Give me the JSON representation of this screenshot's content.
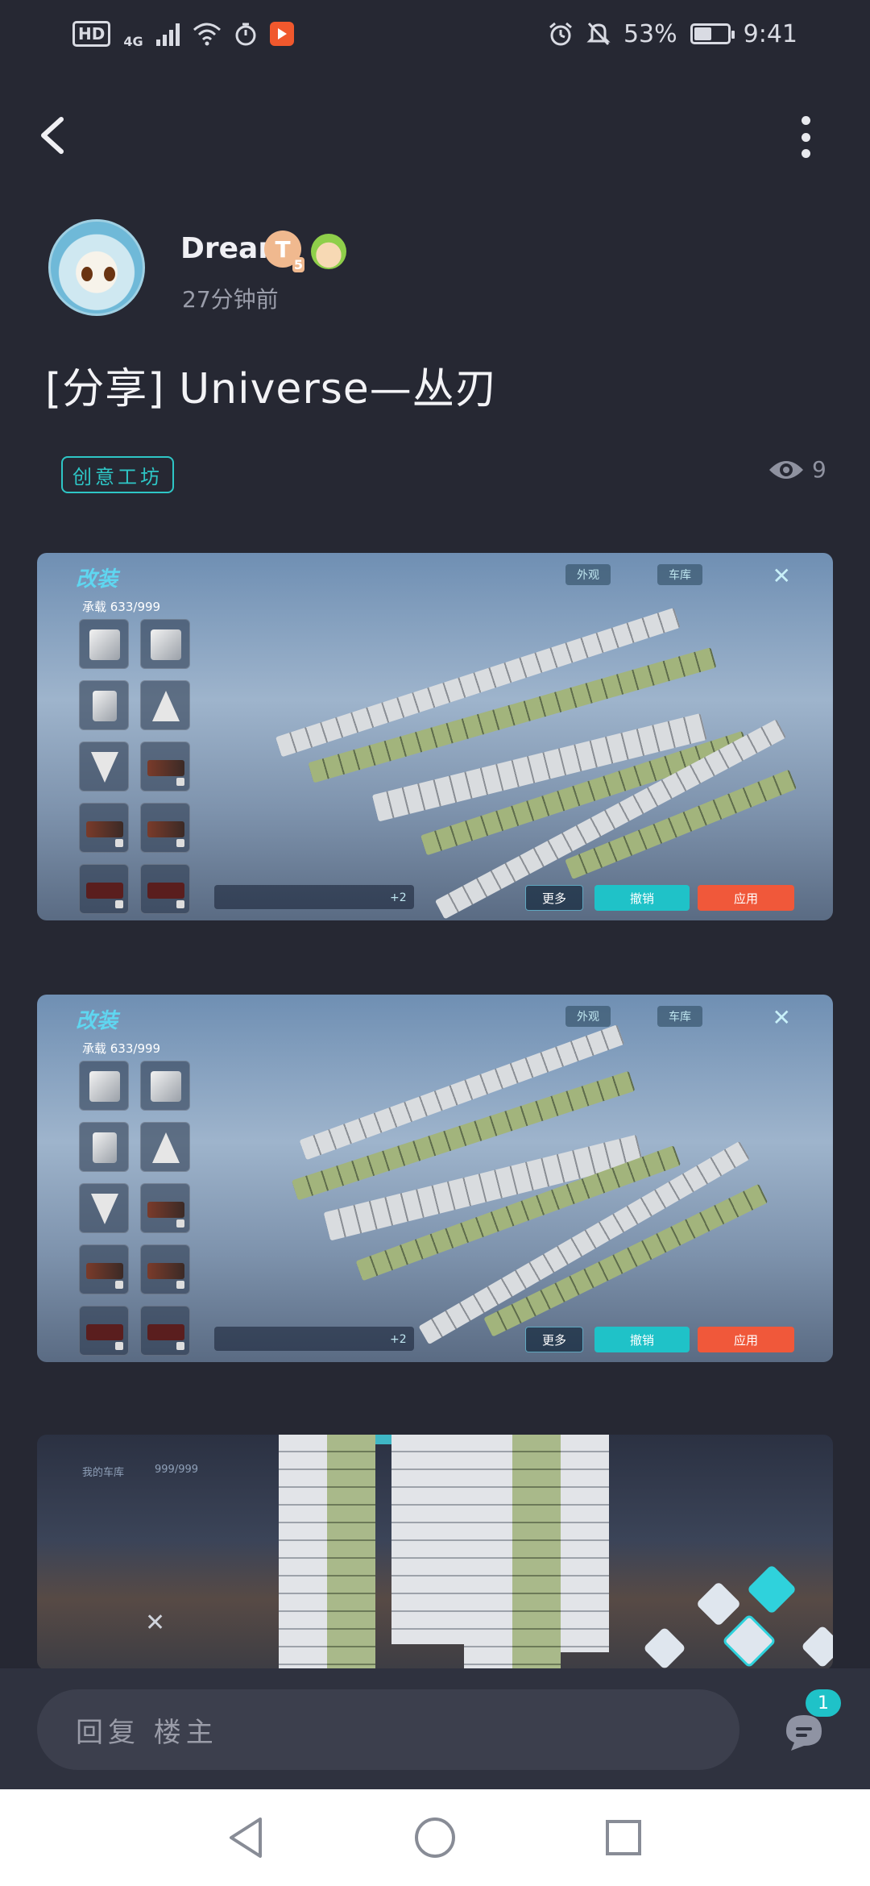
{
  "status_bar": {
    "hd_label": "HD",
    "network_label": "4G",
    "battery_percent_text": "53%",
    "battery_level": 0.53,
    "time": "9:41"
  },
  "post": {
    "author": {
      "name": "Dream",
      "level_badge": "T",
      "level_sub": "5",
      "time_ago": "27分钟前"
    },
    "title": "[分享] Universe—丛刃",
    "tag": "创意工坊",
    "view_count": "9"
  },
  "screenshots": [
    {
      "title": "改装",
      "capacity": "承载 633/999",
      "tabs": [
        "外观",
        "车库"
      ],
      "slot_plus": "+2",
      "buttons": {
        "more": "更多",
        "undo": "撤销",
        "apply": "应用"
      }
    },
    {
      "title": "改装",
      "capacity": "承载 633/999",
      "tabs": [
        "外观",
        "车库"
      ],
      "slot_plus": "+2",
      "buttons": {
        "more": "更多",
        "undo": "撤销",
        "apply": "应用"
      }
    },
    {
      "caption": "我的车库",
      "counter": "999/999"
    }
  ],
  "reply": {
    "placeholder": "回复 楼主",
    "comment_count": "1"
  },
  "colors": {
    "background": "#262833",
    "accent_teal": "#2ec6c6",
    "undo_button": "#1fc2c8",
    "apply_button": "#f0583a"
  },
  "icons": [
    "back-arrow-icon",
    "more-vertical-icon",
    "eye-icon",
    "comment-icon",
    "nav-back-icon",
    "nav-home-icon",
    "nav-recents-icon"
  ]
}
